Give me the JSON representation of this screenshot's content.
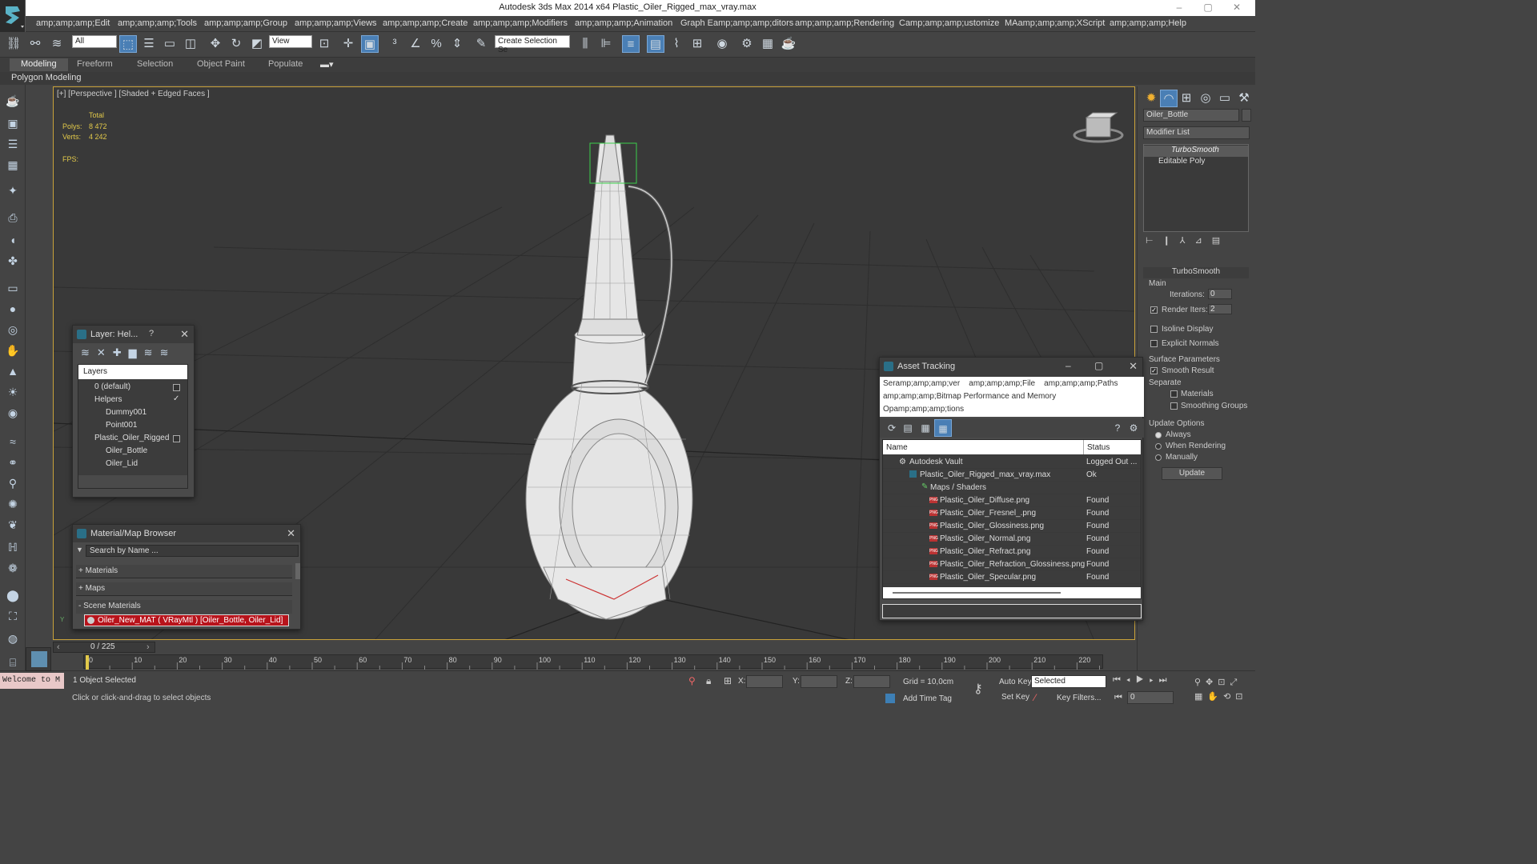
{
  "window": {
    "title": "Autodesk 3ds Max  2014 x64    Plastic_Oiler_Rigged_max_vray.max",
    "controls": [
      "–",
      "▢",
      "✕"
    ]
  },
  "menu": [
    "amp;amp;amp;Edit",
    "amp;amp;amp;Tools",
    "amp;amp;amp;Group",
    "amp;amp;amp;Views",
    "amp;amp;amp;Create",
    "amp;amp;amp;Modifiers",
    "amp;amp;amp;Animation",
    "Graph Eamp;amp;amp;ditors",
    "amp;amp;amp;Rendering",
    "Camp;amp;amp;ustomize",
    "MAamp;amp;amp;XScript",
    "amp;amp;amp;Help"
  ],
  "toolbar": {
    "filter_value": "All",
    "refcoord_value": "View",
    "selection_set_placeholder": "Create Selection Se"
  },
  "ribbon": {
    "tabs": [
      "Modeling",
      "Freeform",
      "Selection",
      "Object Paint",
      "Populate"
    ],
    "active_tab": "Modeling",
    "sub_label": "Polygon Modeling"
  },
  "viewport": {
    "label": "[+] [Perspective ] [Shaded + Edged Faces ]",
    "stats": {
      "total_label": "Total",
      "polys_label": "Polys:",
      "polys_value": "8 472",
      "verts_label": "Verts:",
      "verts_value": "4 242",
      "fps_label": "FPS:"
    }
  },
  "command_panel": {
    "object_name": "Oiler_Bottle",
    "modifier_list": "Modifier List",
    "stack": [
      "TurboSmooth",
      "Editable Poly"
    ],
    "rollout_title": "TurboSmooth",
    "main_label": "Main",
    "iterations_label": "Iterations:",
    "iterations_value": "0",
    "render_iters_label": "Render Iters:",
    "render_iters_value": "2",
    "isoline_label": "Isoline Display",
    "explicit_normals_label": "Explicit Normals",
    "surface_params_label": "Surface Parameters",
    "smooth_result_label": "Smooth Result",
    "separate_label": "Separate",
    "materials_label": "Materials",
    "smoothing_groups_label": "Smoothing Groups",
    "update_options_label": "Update Options",
    "always_label": "Always",
    "when_rendering_label": "When Rendering",
    "manually_label": "Manually",
    "update_button": "Update"
  },
  "layer_window": {
    "title": "Layer: Hel...",
    "help": "?",
    "column": "Layers",
    "rows": [
      {
        "label": "0 (default)",
        "indent": 0
      },
      {
        "label": "Helpers",
        "indent": 0
      },
      {
        "label": "Dummy001",
        "indent": 1
      },
      {
        "label": "Point001",
        "indent": 1
      },
      {
        "label": "Plastic_Oiler_Rigged",
        "indent": 0
      },
      {
        "label": "Oiler_Bottle",
        "indent": 1
      },
      {
        "label": "Oiler_Lid",
        "indent": 1
      }
    ]
  },
  "material_browser": {
    "title": "Material/Map Browser",
    "search_placeholder": "Search by Name ...",
    "groups": [
      "+ Materials",
      "+ Maps",
      "- Scene Materials"
    ],
    "scene_material": "Oiler_New_MAT ( VRayMtl ) [Oiler_Bottle, Oiler_Lid]"
  },
  "asset_tracking": {
    "title": "Asset Tracking",
    "menu_line1": "Seramp;amp;amp;ver    amp;amp;amp;File    amp;amp;amp;Paths",
    "menu_line2": "amp;amp;amp;Bitmap Performance and Memory",
    "menu_line3": "Opamp;amp;amp;tions",
    "col_name": "Name",
    "col_status": "Status",
    "rows": [
      {
        "name": "Autodesk Vault",
        "status": "Logged Out ...",
        "indent": 0
      },
      {
        "name": "Plastic_Oiler_Rigged_max_vray.max",
        "status": "Ok",
        "indent": 1
      },
      {
        "name": "Maps / Shaders",
        "status": "",
        "indent": 2
      },
      {
        "name": "Plastic_Oiler_Diffuse.png",
        "status": "Found",
        "indent": 3
      },
      {
        "name": "Plastic_Oiler_Fresnel_.png",
        "status": "Found",
        "indent": 3
      },
      {
        "name": "Plastic_Oiler_Glossiness.png",
        "status": "Found",
        "indent": 3
      },
      {
        "name": "Plastic_Oiler_Normal.png",
        "status": "Found",
        "indent": 3
      },
      {
        "name": "Plastic_Oiler_Refract.png",
        "status": "Found",
        "indent": 3
      },
      {
        "name": "Plastic_Oiler_Refraction_Glossiness.png",
        "status": "Found",
        "indent": 3
      },
      {
        "name": "Plastic_Oiler_Specular.png",
        "status": "Found",
        "indent": 3
      }
    ]
  },
  "timeline": {
    "frame_display": "0 / 225",
    "ticks": [
      "0",
      "10",
      "20",
      "30",
      "40",
      "50",
      "60",
      "70",
      "80",
      "90",
      "100",
      "110",
      "120",
      "130",
      "140",
      "150",
      "160",
      "170",
      "180",
      "190",
      "200",
      "210",
      "220"
    ]
  },
  "status": {
    "welcome": "Welcome to M",
    "selected_text": "1 Object Selected",
    "prompt": "Click or click-and-drag to select objects",
    "x_label": "X:",
    "y_label": "Y:",
    "z_label": "Z:",
    "grid": "Grid = 10,0cm",
    "add_time_tag": "Add Time Tag",
    "auto_key": "Auto Key",
    "set_key": "Set Key",
    "selected_dropdown": "Selected",
    "key_filters": "Key Filters...",
    "frame_value": "0"
  }
}
